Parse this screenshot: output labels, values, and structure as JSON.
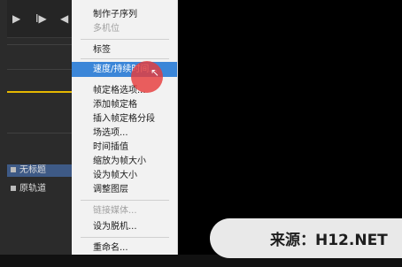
{
  "context_menu": {
    "items": [
      {
        "label": "制作子序列",
        "state": "enabled"
      },
      {
        "label": "多机位",
        "state": "disabled"
      },
      {
        "label": "标签",
        "state": "enabled"
      },
      {
        "label": "速度/持续时间...",
        "state": "highlighted"
      },
      {
        "label": "帧定格选项...",
        "state": "enabled"
      },
      {
        "label": "添加帧定格",
        "state": "enabled"
      },
      {
        "label": "插入帧定格分段",
        "state": "enabled"
      },
      {
        "label": "场选项...",
        "state": "enabled"
      },
      {
        "label": "时间插值",
        "state": "enabled"
      },
      {
        "label": "缩放为帧大小",
        "state": "enabled"
      },
      {
        "label": "设为帧大小",
        "state": "enabled"
      },
      {
        "label": "调整图层",
        "state": "enabled"
      },
      {
        "label": "链接媒体...",
        "state": "disabled"
      },
      {
        "label": "设为脱机...",
        "state": "enabled"
      },
      {
        "label": "重命名...",
        "state": "enabled"
      }
    ],
    "highlight_color": "#3b86d8"
  },
  "tracks": [
    {
      "label": "无标题",
      "selected": true
    },
    {
      "label": "原轨道",
      "selected": false
    }
  ],
  "toolbar": {
    "play": "▶",
    "step": "I▶",
    "more": "◀"
  },
  "watermark": {
    "text": "来源：H12.NET"
  }
}
